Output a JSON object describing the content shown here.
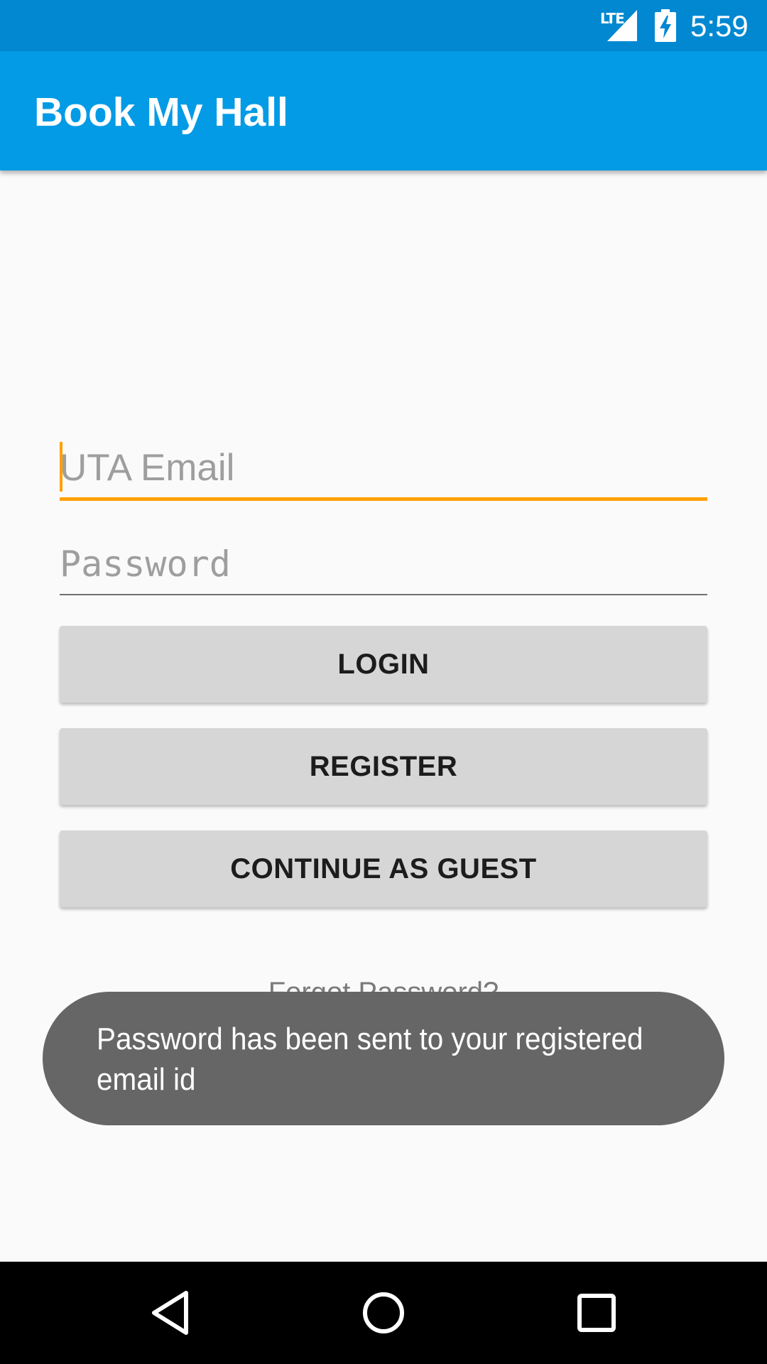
{
  "status_bar": {
    "network": "LTE",
    "time": "5:59",
    "icons": [
      "lte-signal-icon",
      "battery-charging-icon"
    ]
  },
  "app_bar": {
    "title": "Book My Hall"
  },
  "form": {
    "email_placeholder": "UTA Email",
    "email_value": "",
    "password_placeholder": "Password",
    "password_value": ""
  },
  "buttons": {
    "login": "LOGIN",
    "register": "REGISTER",
    "guest": "CONTINUE AS GUEST"
  },
  "forgot_password": "Forgot Password?",
  "toast": {
    "line1": "Password has been sent to your registered",
    "line2": "email id"
  },
  "nav_bar": {
    "icons": [
      "back-icon",
      "home-icon",
      "recents-icon"
    ]
  },
  "colors": {
    "status_bar": "#0288d1",
    "app_bar": "#039be5",
    "accent": "#ffa000",
    "button": "#d6d6d6",
    "toast": "#666666",
    "background": "#fafafa"
  }
}
